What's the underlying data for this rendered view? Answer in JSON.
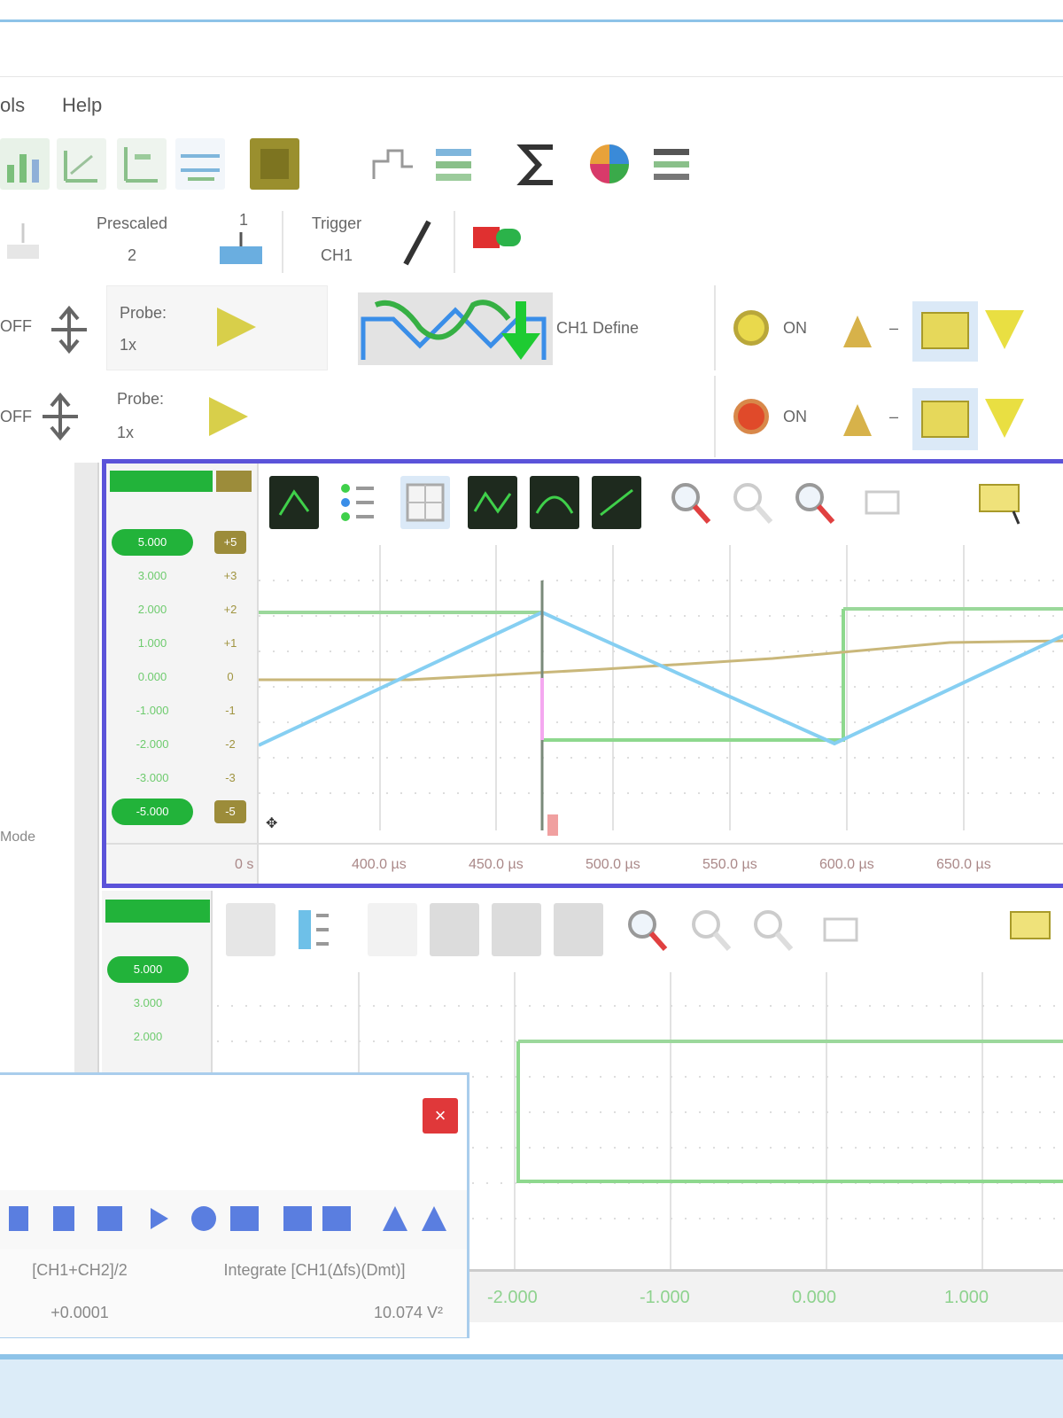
{
  "menu": {
    "item_partial": "ols",
    "help": "Help"
  },
  "toolbar2": {
    "prescaler_label": "Prescaled",
    "prescaler_value": "2",
    "timebase_value": "1",
    "trigger_label": "Trigger",
    "trigger_value": "CH1"
  },
  "channels": {
    "ch1": {
      "partial_label": "OFF",
      "probe_label": "Probe:",
      "probe_value": "1x",
      "status": "ON",
      "dash": "–",
      "mode": "CH1 Define"
    },
    "ch2": {
      "partial_label": "OFF",
      "probe_label": "Probe:",
      "probe_value": "1x",
      "status": "ON",
      "dash": "–"
    }
  },
  "scope1": {
    "volt_labels": [
      "5.000",
      "3.000",
      "2.000",
      "1.000",
      "0.000",
      "-1.000",
      "-2.000",
      "-3.000",
      "-5.000"
    ],
    "offsets": [
      "+5",
      "+3",
      "+2",
      "+1",
      "0",
      "-1",
      "-2",
      "-3",
      "-5"
    ],
    "time_labels": [
      "0 s",
      "400.0 µs",
      "450.0 µs",
      "500.0 µs",
      "550.0 µs",
      "600.0 µs",
      "650.0 µs"
    ],
    "colors": {
      "frame": "#5b53d9",
      "ch1": "#7ec7ef",
      "ch2": "#b5a25a",
      "logic": "#8ed88e",
      "cursor": "#4a8a4a"
    }
  },
  "scope2": {
    "volt_labels": [
      "5.000",
      "3.000",
      "2.000"
    ],
    "bottom_labels": [
      "-2.000",
      "-1.000",
      "0.000",
      "1.000"
    ]
  },
  "popup": {
    "cell1": "[CH1+CH2]/2",
    "cell2": "Integrate [CH1(Δfs)(Dmt)]",
    "value1": "+0.0001",
    "value2": "10.074 V²"
  },
  "side_label": "Mode"
}
